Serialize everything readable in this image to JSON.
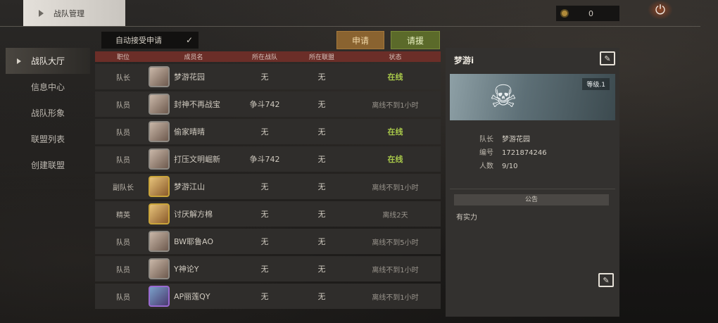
{
  "header": {
    "title": "战队管理",
    "coins": "0"
  },
  "sidebar": {
    "items": [
      {
        "label": "战队大厅",
        "active": true
      },
      {
        "label": "信息中心",
        "active": false
      },
      {
        "label": "战队形象",
        "active": false
      },
      {
        "label": "联盟列表",
        "active": false
      },
      {
        "label": "创建联盟",
        "active": false
      }
    ]
  },
  "controls": {
    "auto_accept_label": "自动接受申请",
    "auto_accept_checked": "✓",
    "apply_label": "申请",
    "invite_label": "请援"
  },
  "table": {
    "headers": [
      "职位",
      "成员名",
      "所在战队",
      "所在联盟",
      "状态"
    ],
    "rows": [
      {
        "position": "队长",
        "name": "梦游花园",
        "team": "无",
        "alliance": "无",
        "status": "在线",
        "online": true,
        "avatar": "gray"
      },
      {
        "position": "队员",
        "name": "封神不再战宝",
        "team": "争斗742",
        "alliance": "无",
        "status": "离线不到1小时",
        "online": false,
        "avatar": "gray"
      },
      {
        "position": "队员",
        "name": "偷家晴晴",
        "team": "无",
        "alliance": "无",
        "status": "在线",
        "online": true,
        "avatar": "gray"
      },
      {
        "position": "队员",
        "name": "打压文明崛新",
        "team": "争斗742",
        "alliance": "无",
        "status": "在线",
        "online": true,
        "avatar": "gray"
      },
      {
        "position": "副队长",
        "name": "梦游江山",
        "team": "无",
        "alliance": "无",
        "status": "离线不到1小时",
        "online": false,
        "avatar": "gold"
      },
      {
        "position": "精英",
        "name": "讨厌解方棉",
        "team": "无",
        "alliance": "无",
        "status": "离线2天",
        "online": false,
        "avatar": "gold"
      },
      {
        "position": "队员",
        "name": "BW耶鲁AO",
        "team": "无",
        "alliance": "无",
        "status": "离线不到5小时",
        "online": false,
        "avatar": "gray"
      },
      {
        "position": "队员",
        "name": "Y神论Y",
        "team": "无",
        "alliance": "无",
        "status": "离线不到1小时",
        "online": false,
        "avatar": "gray"
      },
      {
        "position": "队员",
        "name": "AP丽莲QY",
        "team": "无",
        "alliance": "无",
        "status": "离线不到1小时",
        "online": false,
        "avatar": "purple"
      }
    ]
  },
  "panel": {
    "team_name": "梦游i",
    "level": "等级.1",
    "captain_label": "队长",
    "captain": "梦游花园",
    "id_label": "编号",
    "id": "1721874246",
    "members_label": "人数",
    "members": "9/10",
    "notice_title": "公告",
    "notice_text": "有实力"
  }
}
